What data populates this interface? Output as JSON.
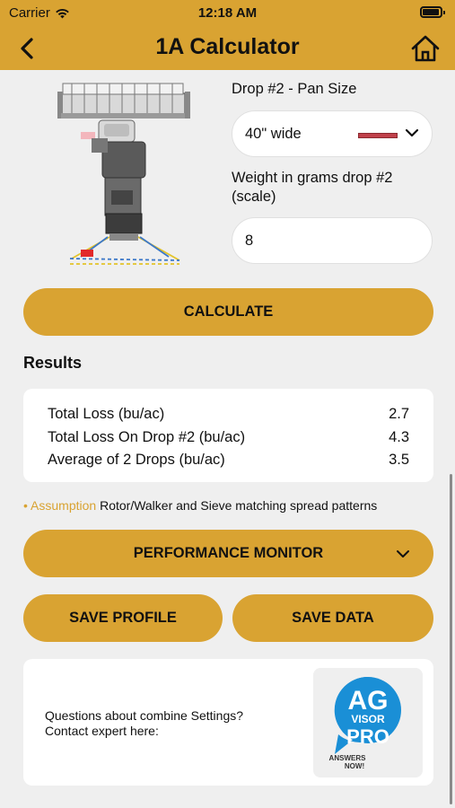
{
  "status": {
    "carrier": "Carrier",
    "time": "12:18 AM"
  },
  "header": {
    "title": "1A Calculator",
    "back_icon": "chevron-left-icon",
    "home_icon": "home-icon"
  },
  "form": {
    "pan_label": "Drop #2 - Pan Size",
    "pan_value": "40\" wide",
    "weight_label": "Weight in grams drop #2 (scale)",
    "weight_value": "8"
  },
  "actions": {
    "calculate": "CALCULATE",
    "performance_monitor": "PERFORMANCE MONITOR",
    "save_profile": "SAVE PROFILE",
    "save_data": "SAVE DATA"
  },
  "results": {
    "title": "Results",
    "rows": [
      {
        "label": "Total Loss (bu/ac)",
        "value": "2.7"
      },
      {
        "label": "Total Loss On Drop #2 (bu/ac)",
        "value": "4.3"
      },
      {
        "label": "Average of 2 Drops (bu/ac)",
        "value": "3.5"
      }
    ]
  },
  "assumption": {
    "label": "Assumption",
    "text": "Rotor/Walker and Sieve matching spread patterns"
  },
  "promo": {
    "line1": "Questions about combine Settings?",
    "line2": "Contact expert here:",
    "logo": {
      "ag": "AG",
      "visor": "VISOR",
      "pro": "PRO",
      "answers": "ANSWERS",
      "now": "NOW!"
    }
  },
  "colors": {
    "accent": "#d9a332",
    "background": "#efefef",
    "logo_blue": "#1a8fd6"
  }
}
